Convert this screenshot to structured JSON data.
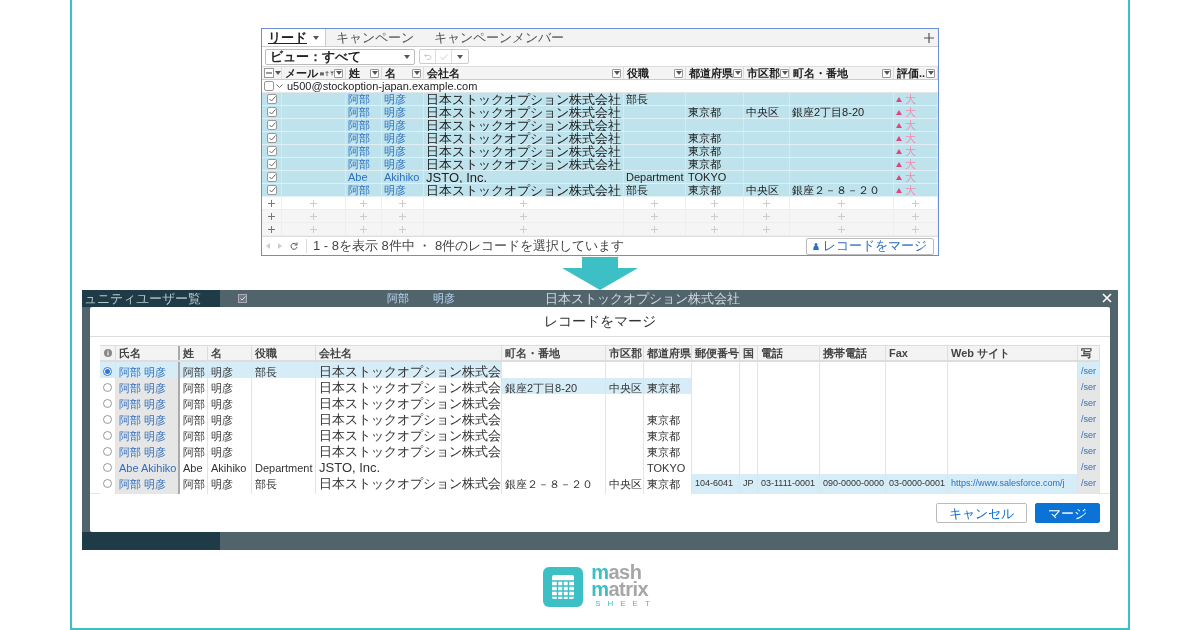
{
  "top_window": {
    "tabs": [
      {
        "label": "リード",
        "selected": true
      },
      {
        "label": "キャンペーン",
        "selected": false
      },
      {
        "label": "キャンペーンメンバー",
        "selected": false
      }
    ],
    "view_select": {
      "value": "ビュー：すべて"
    },
    "toolbar": {
      "undo_disabled": true,
      "save_disabled": true
    },
    "select_all_indeterminate": true,
    "columns": [
      "メール",
      "姓",
      "名",
      "会社名",
      "役職",
      "都道府県",
      "市区郡",
      "町名・番地",
      "評価.."
    ],
    "group": {
      "label": "u500@stockoption-japan.example.com",
      "checked": false
    },
    "rows": [
      {
        "selected": true,
        "checked": true,
        "cells": {
          "last": "阿部",
          "first": "明彦",
          "company": "日本ストックオプション株式会社",
          "title": "部長",
          "rating": "大"
        }
      },
      {
        "selected": true,
        "checked": true,
        "cells": {
          "last": "阿部",
          "first": "明彦",
          "company": "日本ストックオプション株式会社",
          "prefecture": "東京都",
          "city": "中央区",
          "street": "銀座2丁目8-20",
          "rating": "大"
        }
      },
      {
        "selected": true,
        "checked": true,
        "cells": {
          "last": "阿部",
          "first": "明彦",
          "company": "日本ストックオプション株式会社",
          "rating": "大"
        }
      },
      {
        "selected": true,
        "checked": true,
        "cells": {
          "last": "阿部",
          "first": "明彦",
          "company": "日本ストックオプション株式会社",
          "prefecture": "東京都",
          "rating": "大"
        }
      },
      {
        "selected": true,
        "checked": true,
        "cells": {
          "last": "阿部",
          "first": "明彦",
          "company": "日本ストックオプション株式会社",
          "prefecture": "東京都",
          "rating": "大"
        }
      },
      {
        "selected": true,
        "checked": true,
        "cells": {
          "last": "阿部",
          "first": "明彦",
          "company": "日本ストックオプション株式会社",
          "prefecture": "東京都",
          "rating": "大"
        }
      },
      {
        "selected": true,
        "checked": true,
        "cells": {
          "last": "Abe",
          "first": "Akihiko",
          "company": "JSTO, Inc.",
          "title": "Department",
          "prefecture": "TOKYO",
          "rating": "大"
        }
      },
      {
        "selected": true,
        "checked": true,
        "cells": {
          "last": "阿部",
          "first": "明彦",
          "company": "日本ストックオプション株式会社",
          "title": "部長",
          "prefecture": "東京都",
          "city": "中央区",
          "street": "銀座２－８－２０",
          "rating": "大"
        }
      }
    ],
    "footer": {
      "status": "1 - 8を表示 8件中 ・ 8件のレコードを選択しています",
      "merge_button": "レコードをマージ"
    }
  },
  "merge_screen": {
    "sidebar_item": "ュニティユーザー覧",
    "background_row": {
      "checked": true,
      "last": "阿部",
      "first": "明彦",
      "company": "日本ストックオプション株式会社"
    },
    "modal": {
      "title": "レコードをマージ",
      "columns": [
        "氏名",
        "姓",
        "名",
        "役職",
        "会社名",
        "町名・番地",
        "市区郡",
        "都道府県",
        "郵便番号",
        "国",
        "電話",
        "携帯電話",
        "Fax",
        "Web サイト",
        "写"
      ],
      "rows": [
        {
          "selected": true,
          "cells": [
            {
              "text": "阿部 明彦",
              "highlighted": true
            },
            {
              "text": "阿部",
              "highlighted": true
            },
            {
              "text": "明彦",
              "highlighted": true
            },
            {
              "text": "部長",
              "highlighted": true
            },
            {
              "text": "日本ストックオプション株式会",
              "highlighted": true
            },
            {
              "highlighted": false
            },
            {
              "highlighted": false
            },
            {
              "highlighted": false
            },
            {
              "highlighted": false
            },
            {
              "highlighted": false
            },
            {
              "highlighted": false
            },
            {
              "highlighted": false
            },
            {
              "highlighted": false
            },
            {
              "highlighted": false
            },
            {
              "text": "/ser",
              "highlighted": true
            }
          ]
        },
        {
          "selected": false,
          "cells": [
            {
              "text": "阿部 明彦",
              "highlighted": false
            },
            {
              "text": "阿部",
              "highlighted": false
            },
            {
              "text": "明彦",
              "highlighted": false
            },
            {
              "highlighted": false
            },
            {
              "text": "日本ストックオプション株式会",
              "highlighted": false
            },
            {
              "text": "銀座2丁目8-20",
              "highlighted": true
            },
            {
              "text": "中央区",
              "highlighted": true
            },
            {
              "text": "東京都",
              "highlighted": true
            },
            {
              "highlighted": false
            },
            {
              "highlighted": false
            },
            {
              "highlighted": false
            },
            {
              "highlighted": false
            },
            {
              "highlighted": false
            },
            {
              "highlighted": false
            },
            {
              "text": "/ser",
              "highlighted": false
            }
          ]
        },
        {
          "selected": false,
          "cells": [
            {
              "text": "阿部 明彦",
              "highlighted": false
            },
            {
              "text": "阿部",
              "highlighted": false
            },
            {
              "text": "明彦",
              "highlighted": false
            },
            {
              "highlighted": false
            },
            {
              "text": "日本ストックオプション株式会",
              "highlighted": false
            },
            {
              "highlighted": false
            },
            {
              "highlighted": false
            },
            {
              "highlighted": false
            },
            {
              "highlighted": false
            },
            {
              "highlighted": false
            },
            {
              "highlighted": false
            },
            {
              "highlighted": false
            },
            {
              "highlighted": false
            },
            {
              "highlighted": false
            },
            {
              "text": "/ser",
              "highlighted": false
            }
          ]
        },
        {
          "selected": false,
          "cells": [
            {
              "text": "阿部 明彦",
              "highlighted": false
            },
            {
              "text": "阿部",
              "highlighted": false
            },
            {
              "text": "明彦",
              "highlighted": false
            },
            {
              "highlighted": false
            },
            {
              "text": "日本ストックオプション株式会",
              "highlighted": false
            },
            {
              "highlighted": false
            },
            {
              "highlighted": false
            },
            {
              "text": "東京都",
              "highlighted": false
            },
            {
              "highlighted": false
            },
            {
              "highlighted": false
            },
            {
              "highlighted": false
            },
            {
              "highlighted": false
            },
            {
              "highlighted": false
            },
            {
              "highlighted": false
            },
            {
              "text": "/ser",
              "highlighted": false
            }
          ]
        },
        {
          "selected": false,
          "cells": [
            {
              "text": "阿部 明彦",
              "highlighted": false
            },
            {
              "text": "阿部",
              "highlighted": false
            },
            {
              "text": "明彦",
              "highlighted": false
            },
            {
              "highlighted": false
            },
            {
              "text": "日本ストックオプション株式会",
              "highlighted": false
            },
            {
              "highlighted": false
            },
            {
              "highlighted": false
            },
            {
              "text": "東京都",
              "highlighted": false
            },
            {
              "highlighted": false
            },
            {
              "highlighted": false
            },
            {
              "highlighted": false
            },
            {
              "highlighted": false
            },
            {
              "highlighted": false
            },
            {
              "highlighted": false
            },
            {
              "text": "/ser",
              "highlighted": false
            }
          ]
        },
        {
          "selected": false,
          "cells": [
            {
              "text": "阿部 明彦",
              "highlighted": false
            },
            {
              "text": "阿部",
              "highlighted": false
            },
            {
              "text": "明彦",
              "highlighted": false
            },
            {
              "highlighted": false
            },
            {
              "text": "日本ストックオプション株式会",
              "highlighted": false
            },
            {
              "highlighted": false
            },
            {
              "highlighted": false
            },
            {
              "text": "東京都",
              "highlighted": false
            },
            {
              "highlighted": false
            },
            {
              "highlighted": false
            },
            {
              "highlighted": false
            },
            {
              "highlighted": false
            },
            {
              "highlighted": false
            },
            {
              "highlighted": false
            },
            {
              "text": "/ser",
              "highlighted": false
            }
          ]
        },
        {
          "selected": false,
          "cells": [
            {
              "text": "Abe Akihiko",
              "highlighted": false
            },
            {
              "text": "Abe",
              "highlighted": false
            },
            {
              "text": "Akihiko",
              "highlighted": false
            },
            {
              "text": "Department",
              "highlighted": false
            },
            {
              "text": "JSTO, Inc.",
              "highlighted": false
            },
            {
              "highlighted": false
            },
            {
              "highlighted": false
            },
            {
              "text": "TOKYO",
              "highlighted": false
            },
            {
              "highlighted": false
            },
            {
              "highlighted": false
            },
            {
              "highlighted": false
            },
            {
              "highlighted": false
            },
            {
              "highlighted": false
            },
            {
              "highlighted": false
            },
            {
              "text": "/ser",
              "highlighted": false
            }
          ]
        },
        {
          "selected": false,
          "cells": [
            {
              "text": "阿部 明彦",
              "highlighted": false
            },
            {
              "text": "阿部",
              "highlighted": false
            },
            {
              "text": "明彦",
              "highlighted": false
            },
            {
              "text": "部長",
              "highlighted": false
            },
            {
              "text": "日本ストックオプション株式会",
              "highlighted": false
            },
            {
              "text": "銀座２－８－２０",
              "highlighted": false
            },
            {
              "text": "中央区",
              "highlighted": false
            },
            {
              "text": "東京都",
              "highlighted": false
            },
            {
              "text": "104-6041",
              "highlighted": true
            },
            {
              "text": "JP",
              "highlighted": true
            },
            {
              "text": "03-1111-0001",
              "highlighted": true
            },
            {
              "text": "090-0000-0000",
              "highlighted": true
            },
            {
              "text": "03-0000-0001",
              "highlighted": true
            },
            {
              "text": "https://www.salesforce.com/j",
              "highlighted": true
            },
            {
              "text": "/ser",
              "highlighted": false
            }
          ]
        }
      ],
      "buttons": [
        {
          "label": "キャンセル",
          "kind": "secondary"
        },
        {
          "label": "マージ",
          "kind": "primary"
        }
      ]
    }
  },
  "logo": {
    "lines": [
      {
        "initial": "m",
        "rest": "ash"
      },
      {
        "initial": "m",
        "rest": "atrix"
      }
    ],
    "tagline": "SHEET"
  }
}
